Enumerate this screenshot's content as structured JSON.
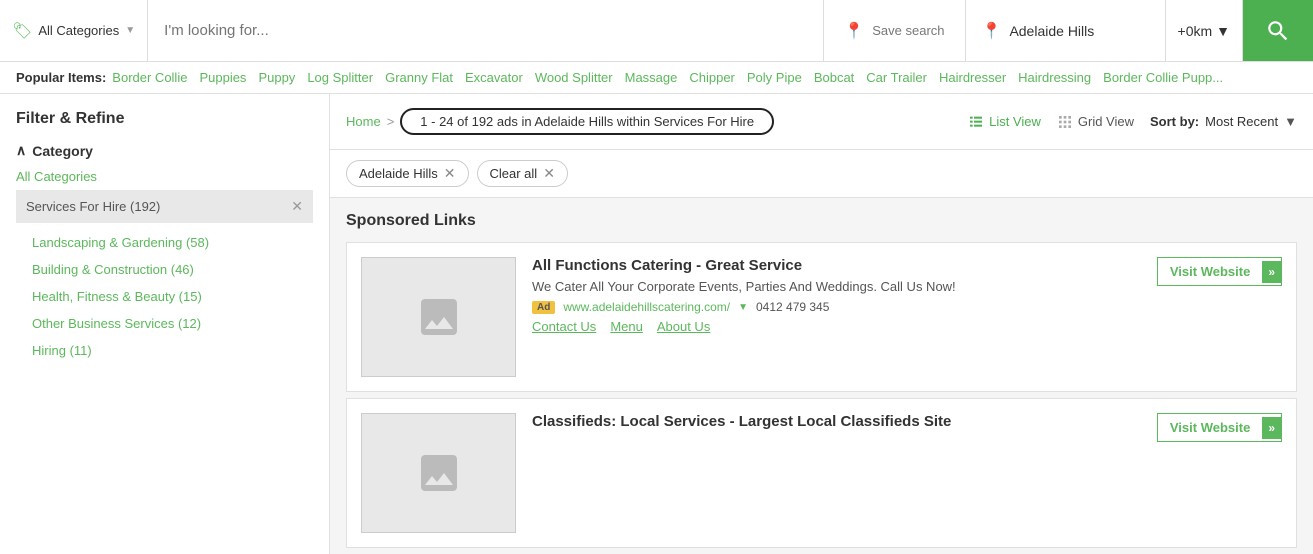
{
  "search": {
    "category_label": "All Categories",
    "placeholder": "I'm looking for...",
    "save_search_label": "Save search",
    "location_value": "Adelaide Hills",
    "radius_value": "+0km"
  },
  "popular": {
    "label": "Popular Items:",
    "items": [
      "Border Collie",
      "Puppies",
      "Puppy",
      "Log Splitter",
      "Granny Flat",
      "Excavator",
      "Wood Splitter",
      "Massage",
      "Chipper",
      "Poly Pipe",
      "Bobcat",
      "Car Trailer",
      "Hairdresser",
      "Hairdressing",
      "Border Collie Pupp..."
    ]
  },
  "results": {
    "breadcrumb_home": "Home",
    "results_text": "1 - 24 of 192 ads in Adelaide Hills within Services For Hire",
    "list_view_label": "List View",
    "grid_view_label": "Grid View",
    "sort_label": "Sort by:",
    "sort_value": "Most Recent"
  },
  "filters": {
    "active_tags": [
      {
        "label": "Adelaide Hills"
      },
      {
        "label": "Clear all"
      }
    ]
  },
  "sidebar": {
    "title": "Filter & Refine",
    "category_section": "Category",
    "all_categories_label": "All Categories",
    "selected_category": "Services For Hire (192)",
    "sub_categories": [
      {
        "label": "Landscaping & Gardening (58)"
      },
      {
        "label": "Building & Construction (46)"
      },
      {
        "label": "Health, Fitness & Beauty (15)"
      },
      {
        "label": "Other Business Services (12)"
      },
      {
        "label": "Hiring (11)"
      }
    ]
  },
  "sponsored": {
    "title": "Sponsored Links",
    "ads": [
      {
        "title": "All Functions Catering - Great Service",
        "description": "We Cater All Your Corporate Events, Parties And Weddings. Call Us Now!",
        "url": "www.adelaidehillscatering.com/",
        "phone": "0412 479 345",
        "links": [
          "Contact Us",
          "Menu",
          "About Us"
        ],
        "visit_label": "Visit Website"
      },
      {
        "title": "Classifieds: Local Services - Largest Local Classifieds Site",
        "description": "",
        "url": "",
        "phone": "",
        "links": [],
        "visit_label": "Visit Website"
      }
    ]
  }
}
